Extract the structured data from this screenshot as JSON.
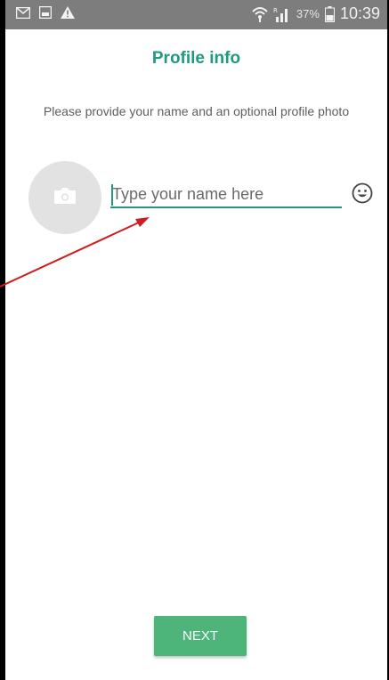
{
  "status_bar": {
    "battery_percent": "37%",
    "time": "10:39",
    "icons": [
      "mail-icon",
      "gallery-icon",
      "warning-icon",
      "wifi-icon",
      "signal-icon",
      "battery-icon"
    ]
  },
  "profile": {
    "title": "Profile info",
    "subtitle": "Please provide your name and an optional profile photo",
    "name_placeholder": "Type your name here",
    "name_value": ""
  },
  "actions": {
    "next_label": "NEXT"
  },
  "colors": {
    "accent": "#1f9a80",
    "button": "#4db47a",
    "annotation_arrow": "#d01c1c"
  }
}
